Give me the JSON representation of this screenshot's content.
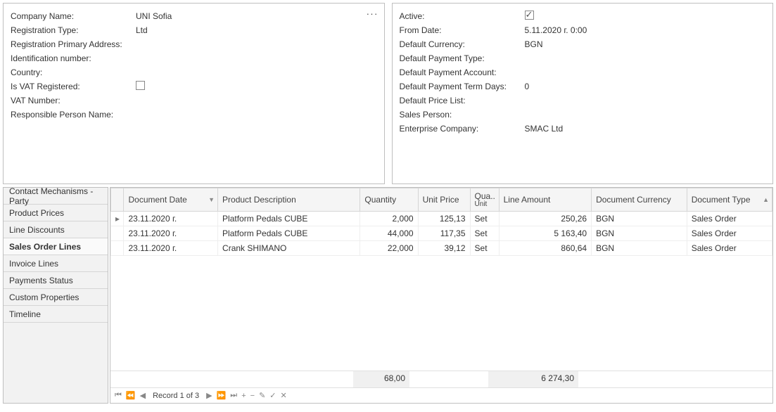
{
  "left_panel": {
    "company_name_label": "Company Name:",
    "company_name_value": "UNI Sofia",
    "registration_type_label": "Registration Type:",
    "registration_type_value": "Ltd",
    "reg_primary_addr_label": "Registration Primary Address:",
    "reg_primary_addr_value": "",
    "ident_number_label": "Identification number:",
    "ident_number_value": "",
    "country_label": "Country:",
    "country_value": "",
    "is_vat_reg_label": "Is VAT Registered:",
    "vat_number_label": "VAT Number:",
    "vat_number_value": "",
    "responsible_person_label": "Responsible Person Name:",
    "responsible_person_value": ""
  },
  "right_panel": {
    "active_label": "Active:",
    "from_date_label": "From Date:",
    "from_date_value": "5.11.2020 г. 0:00",
    "default_currency_label": "Default Currency:",
    "default_currency_value": "BGN",
    "default_payment_type_label": "Default Payment Type:",
    "default_payment_type_value": "",
    "default_payment_account_label": "Default Payment Account:",
    "default_payment_account_value": "",
    "default_payment_term_days_label": "Default Payment Term Days:",
    "default_payment_term_days_value": "0",
    "default_price_list_label": "Default Price List:",
    "default_price_list_value": "",
    "sales_person_label": "Sales Person:",
    "sales_person_value": "",
    "enterprise_company_label": "Enterprise Company:",
    "enterprise_company_value": "SMAC Ltd"
  },
  "sidebar": {
    "items": [
      {
        "label": "Contact Mechanisms - Party"
      },
      {
        "label": "Product Prices"
      },
      {
        "label": "Line Discounts"
      },
      {
        "label": "Sales Order Lines"
      },
      {
        "label": "Invoice Lines"
      },
      {
        "label": "Payments Status"
      },
      {
        "label": "Custom Properties"
      },
      {
        "label": "Timeline"
      }
    ],
    "active_index": 3
  },
  "grid": {
    "headers": {
      "doc_date": "Document Date",
      "product_desc": "Product Description",
      "quantity": "Quantity",
      "unit_price": "Unit Price",
      "qty_unit_l1": "Qua..",
      "qty_unit_l2": "Unit",
      "line_amount": "Line Amount",
      "doc_currency": "Document Currency",
      "doc_type": "Document Type"
    },
    "rows": [
      {
        "doc_date": "23.11.2020 г.",
        "product_desc": "Platform Pedals CUBE",
        "quantity": "2,000",
        "unit_price": "125,13",
        "qty_unit": "Set",
        "line_amount": "250,26",
        "doc_currency": "BGN",
        "doc_type": "Sales Order"
      },
      {
        "doc_date": "23.11.2020 г.",
        "product_desc": "Platform Pedals CUBE",
        "quantity": "44,000",
        "unit_price": "117,35",
        "qty_unit": "Set",
        "line_amount": "5 163,40",
        "doc_currency": "BGN",
        "doc_type": "Sales Order"
      },
      {
        "doc_date": "23.11.2020 г.",
        "product_desc": "Crank SHIMANO",
        "quantity": "22,000",
        "unit_price": "39,12",
        "qty_unit": "Set",
        "line_amount": "860,64",
        "doc_currency": "BGN",
        "doc_type": "Sales Order"
      }
    ],
    "sum_quantity": "68,00",
    "sum_line_amount": "6 274,30"
  },
  "navigator": {
    "record_text": "Record 1 of 3"
  }
}
